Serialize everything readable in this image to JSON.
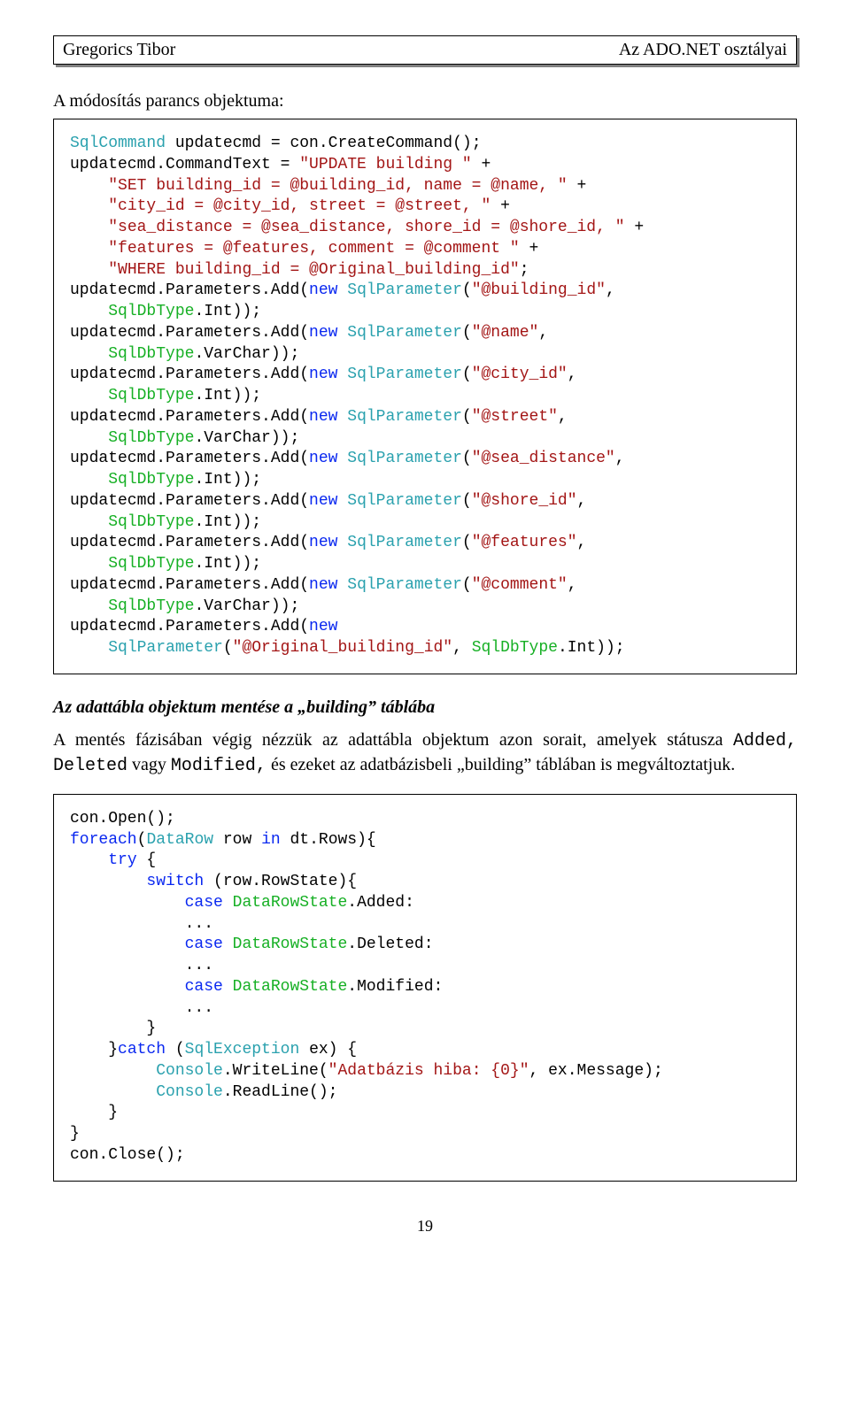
{
  "header": {
    "left": "Gregorics Tibor",
    "right": "Az ADO.NET osztályai"
  },
  "section1_title": "A módosítás parancs objektuma:",
  "code1": [
    {
      "t": "type",
      "v": "SqlCommand"
    },
    {
      "t": "",
      "v": " updatecmd = con.CreateCommand();\n"
    },
    {
      "t": "",
      "v": "updatecmd.CommandText = "
    },
    {
      "t": "str",
      "v": "\"UPDATE building \""
    },
    {
      "t": "",
      "v": " +\n"
    },
    {
      "t": "",
      "v": "    "
    },
    {
      "t": "str",
      "v": "\"SET building_id = @building_id, name = @name, \""
    },
    {
      "t": "",
      "v": " +\n"
    },
    {
      "t": "",
      "v": "    "
    },
    {
      "t": "str",
      "v": "\"city_id = @city_id, street = @street, \""
    },
    {
      "t": "",
      "v": " +\n"
    },
    {
      "t": "",
      "v": "    "
    },
    {
      "t": "str",
      "v": "\"sea_distance = @sea_distance, shore_id = @shore_id, \""
    },
    {
      "t": "",
      "v": " +\n"
    },
    {
      "t": "",
      "v": "    "
    },
    {
      "t": "str",
      "v": "\"features = @features, comment = @comment \""
    },
    {
      "t": "",
      "v": " +\n"
    },
    {
      "t": "",
      "v": "    "
    },
    {
      "t": "str",
      "v": "\"WHERE building_id = @Original_building_id\""
    },
    {
      "t": "",
      "v": ";\n"
    },
    {
      "t": "",
      "v": "updatecmd.Parameters.Add("
    },
    {
      "t": "new",
      "v": "new"
    },
    {
      "t": "",
      "v": " "
    },
    {
      "t": "type",
      "v": "SqlParameter"
    },
    {
      "t": "",
      "v": "("
    },
    {
      "t": "str",
      "v": "\"@building_id\""
    },
    {
      "t": "",
      "v": ",\n"
    },
    {
      "t": "",
      "v": "    "
    },
    {
      "t": "enum",
      "v": "SqlDbType"
    },
    {
      "t": "",
      "v": ".Int));\n"
    },
    {
      "t": "",
      "v": "updatecmd.Parameters.Add("
    },
    {
      "t": "new",
      "v": "new"
    },
    {
      "t": "",
      "v": " "
    },
    {
      "t": "type",
      "v": "SqlParameter"
    },
    {
      "t": "",
      "v": "("
    },
    {
      "t": "str",
      "v": "\"@name\""
    },
    {
      "t": "",
      "v": ",\n"
    },
    {
      "t": "",
      "v": "    "
    },
    {
      "t": "enum",
      "v": "SqlDbType"
    },
    {
      "t": "",
      "v": ".VarChar));\n"
    },
    {
      "t": "",
      "v": "updatecmd.Parameters.Add("
    },
    {
      "t": "new",
      "v": "new"
    },
    {
      "t": "",
      "v": " "
    },
    {
      "t": "type",
      "v": "SqlParameter"
    },
    {
      "t": "",
      "v": "("
    },
    {
      "t": "str",
      "v": "\"@city_id\""
    },
    {
      "t": "",
      "v": ",\n"
    },
    {
      "t": "",
      "v": "    "
    },
    {
      "t": "enum",
      "v": "SqlDbType"
    },
    {
      "t": "",
      "v": ".Int));\n"
    },
    {
      "t": "",
      "v": "updatecmd.Parameters.Add("
    },
    {
      "t": "new",
      "v": "new"
    },
    {
      "t": "",
      "v": " "
    },
    {
      "t": "type",
      "v": "SqlParameter"
    },
    {
      "t": "",
      "v": "("
    },
    {
      "t": "str",
      "v": "\"@street\""
    },
    {
      "t": "",
      "v": ",\n"
    },
    {
      "t": "",
      "v": "    "
    },
    {
      "t": "enum",
      "v": "SqlDbType"
    },
    {
      "t": "",
      "v": ".VarChar));\n"
    },
    {
      "t": "",
      "v": "updatecmd.Parameters.Add("
    },
    {
      "t": "new",
      "v": "new"
    },
    {
      "t": "",
      "v": " "
    },
    {
      "t": "type",
      "v": "SqlParameter"
    },
    {
      "t": "",
      "v": "("
    },
    {
      "t": "str",
      "v": "\"@sea_distance\""
    },
    {
      "t": "",
      "v": ",\n"
    },
    {
      "t": "",
      "v": "    "
    },
    {
      "t": "enum",
      "v": "SqlDbType"
    },
    {
      "t": "",
      "v": ".Int));\n"
    },
    {
      "t": "",
      "v": "updatecmd.Parameters.Add("
    },
    {
      "t": "new",
      "v": "new"
    },
    {
      "t": "",
      "v": " "
    },
    {
      "t": "type",
      "v": "SqlParameter"
    },
    {
      "t": "",
      "v": "("
    },
    {
      "t": "str",
      "v": "\"@shore_id\""
    },
    {
      "t": "",
      "v": ",\n"
    },
    {
      "t": "",
      "v": "    "
    },
    {
      "t": "enum",
      "v": "SqlDbType"
    },
    {
      "t": "",
      "v": ".Int));\n"
    },
    {
      "t": "",
      "v": "updatecmd.Parameters.Add("
    },
    {
      "t": "new",
      "v": "new"
    },
    {
      "t": "",
      "v": " "
    },
    {
      "t": "type",
      "v": "SqlParameter"
    },
    {
      "t": "",
      "v": "("
    },
    {
      "t": "str",
      "v": "\"@features\""
    },
    {
      "t": "",
      "v": ",\n"
    },
    {
      "t": "",
      "v": "    "
    },
    {
      "t": "enum",
      "v": "SqlDbType"
    },
    {
      "t": "",
      "v": ".Int));\n"
    },
    {
      "t": "",
      "v": "updatecmd.Parameters.Add("
    },
    {
      "t": "new",
      "v": "new"
    },
    {
      "t": "",
      "v": " "
    },
    {
      "t": "type",
      "v": "SqlParameter"
    },
    {
      "t": "",
      "v": "("
    },
    {
      "t": "str",
      "v": "\"@comment\""
    },
    {
      "t": "",
      "v": ",\n"
    },
    {
      "t": "",
      "v": "    "
    },
    {
      "t": "enum",
      "v": "SqlDbType"
    },
    {
      "t": "",
      "v": ".VarChar));\n"
    },
    {
      "t": "",
      "v": "updatecmd.Parameters.Add("
    },
    {
      "t": "new",
      "v": "new"
    },
    {
      "t": "",
      "v": "\n"
    },
    {
      "t": "",
      "v": "    "
    },
    {
      "t": "type",
      "v": "SqlParameter"
    },
    {
      "t": "",
      "v": "("
    },
    {
      "t": "str",
      "v": "\"@Original_building_id\""
    },
    {
      "t": "",
      "v": ", "
    },
    {
      "t": "enum",
      "v": "SqlDbType"
    },
    {
      "t": "",
      "v": ".Int));"
    }
  ],
  "section2_heading": "Az adattábla objektum mentése a „building” táblába",
  "section2_body": "A mentés fázisában végig nézzük az adattábla objektum azon sorait, amelyek státusza Added, Deleted vagy Modified, és ezeket az adatbázisbeli „building” táblában is megváltoztatjuk.",
  "body_mono_words": [
    "Added,",
    "Deleted",
    "Modified,"
  ],
  "code2": [
    {
      "t": "",
      "v": "con.Open();\n"
    },
    {
      "t": "new",
      "v": "foreach"
    },
    {
      "t": "",
      "v": "("
    },
    {
      "t": "type",
      "v": "DataRow"
    },
    {
      "t": "",
      "v": " row "
    },
    {
      "t": "new",
      "v": "in"
    },
    {
      "t": "",
      "v": " dt.Rows){\n"
    },
    {
      "t": "",
      "v": "    "
    },
    {
      "t": "new",
      "v": "try"
    },
    {
      "t": "",
      "v": " {\n"
    },
    {
      "t": "",
      "v": "        "
    },
    {
      "t": "new",
      "v": "switch"
    },
    {
      "t": "",
      "v": " (row.RowState){\n"
    },
    {
      "t": "",
      "v": "            "
    },
    {
      "t": "new",
      "v": "case"
    },
    {
      "t": "",
      "v": " "
    },
    {
      "t": "enum",
      "v": "DataRowState"
    },
    {
      "t": "",
      "v": ".Added:\n"
    },
    {
      "t": "",
      "v": "            ...\n"
    },
    {
      "t": "",
      "v": "            "
    },
    {
      "t": "new",
      "v": "case"
    },
    {
      "t": "",
      "v": " "
    },
    {
      "t": "enum",
      "v": "DataRowState"
    },
    {
      "t": "",
      "v": ".Deleted:\n"
    },
    {
      "t": "",
      "v": "            ...\n"
    },
    {
      "t": "",
      "v": "            "
    },
    {
      "t": "new",
      "v": "case"
    },
    {
      "t": "",
      "v": " "
    },
    {
      "t": "enum",
      "v": "DataRowState"
    },
    {
      "t": "",
      "v": ".Modified:\n"
    },
    {
      "t": "",
      "v": "            ...\n"
    },
    {
      "t": "",
      "v": "        }\n"
    },
    {
      "t": "",
      "v": "    }"
    },
    {
      "t": "new",
      "v": "catch"
    },
    {
      "t": "",
      "v": " ("
    },
    {
      "t": "type",
      "v": "SqlException"
    },
    {
      "t": "",
      "v": " ex) {\n"
    },
    {
      "t": "",
      "v": "         "
    },
    {
      "t": "type",
      "v": "Console"
    },
    {
      "t": "",
      "v": ".WriteLine("
    },
    {
      "t": "str",
      "v": "\"Adatbázis hiba: {0}\""
    },
    {
      "t": "",
      "v": ", ex.Message);\n"
    },
    {
      "t": "",
      "v": "         "
    },
    {
      "t": "type",
      "v": "Console"
    },
    {
      "t": "",
      "v": ".ReadLine();\n"
    },
    {
      "t": "",
      "v": "    }\n"
    },
    {
      "t": "",
      "v": "}\n"
    },
    {
      "t": "",
      "v": "con.Close();"
    }
  ],
  "page_number": "19"
}
